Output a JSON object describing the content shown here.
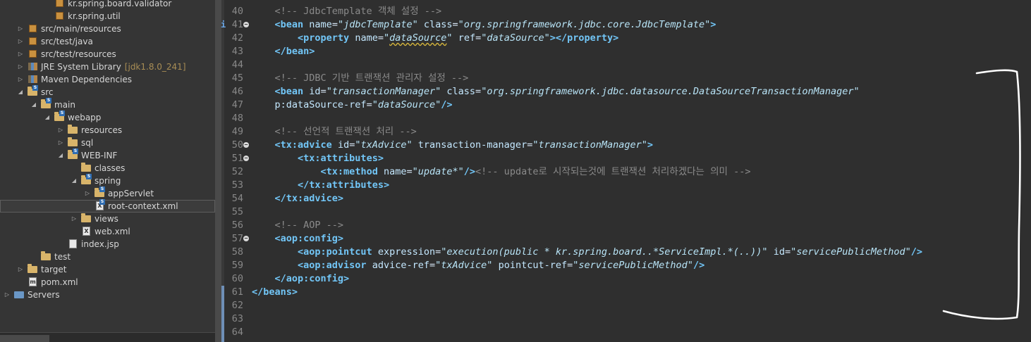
{
  "explorer": {
    "items": [
      {
        "label": "kr.spring.board.validator",
        "type": "package",
        "indent": 3,
        "expanded": null
      },
      {
        "label": "kr.spring.util",
        "type": "package",
        "indent": 3,
        "expanded": null
      },
      {
        "label": "src/main/resources",
        "type": "srcfolder",
        "indent": 1,
        "expanded": false
      },
      {
        "label": "src/test/java",
        "type": "srcfolder",
        "indent": 1,
        "expanded": false
      },
      {
        "label": "src/test/resources",
        "type": "srcfolder",
        "indent": 1,
        "expanded": false
      },
      {
        "label": "JRE System Library",
        "decoration": "[jdk1.8.0_241]",
        "type": "library",
        "indent": 1,
        "expanded": false
      },
      {
        "label": "Maven Dependencies",
        "type": "library",
        "indent": 1,
        "expanded": false
      },
      {
        "label": "src",
        "type": "folder-s",
        "indent": 1,
        "expanded": true
      },
      {
        "label": "main",
        "type": "folder-s",
        "indent": 2,
        "expanded": true
      },
      {
        "label": "webapp",
        "type": "folder-s",
        "indent": 3,
        "expanded": true
      },
      {
        "label": "resources",
        "type": "folder",
        "indent": 4,
        "expanded": false
      },
      {
        "label": "sql",
        "type": "folder",
        "indent": 4,
        "expanded": false
      },
      {
        "label": "WEB-INF",
        "type": "folder-s",
        "indent": 4,
        "expanded": true
      },
      {
        "label": "classes",
        "type": "folder",
        "indent": 5,
        "expanded": null
      },
      {
        "label": "spring",
        "type": "folder-s",
        "indent": 5,
        "expanded": true
      },
      {
        "label": "appServlet",
        "type": "folder-s",
        "indent": 6,
        "expanded": false
      },
      {
        "label": "root-context.xml",
        "type": "xml-s",
        "indent": 6,
        "expanded": null,
        "selected": true
      },
      {
        "label": "views",
        "type": "folder",
        "indent": 5,
        "expanded": false
      },
      {
        "label": "web.xml",
        "type": "xml",
        "indent": 5,
        "expanded": null
      },
      {
        "label": "index.jsp",
        "type": "jsp",
        "indent": 4,
        "expanded": null
      },
      {
        "label": "test",
        "type": "folder",
        "indent": 2,
        "expanded": null
      },
      {
        "label": "target",
        "type": "folder",
        "indent": 1,
        "expanded": false
      },
      {
        "label": "pom.xml",
        "type": "pom",
        "indent": 1,
        "expanded": null
      },
      {
        "label": "Servers",
        "type": "servers",
        "indent": 0,
        "expanded": false
      }
    ]
  },
  "editor": {
    "lines": [
      {
        "num": "40",
        "segs": [
          [
            "    ",
            "p"
          ],
          [
            "<!-- JdbcTemplate 객체 설정 -->",
            "c"
          ]
        ]
      },
      {
        "num": "41",
        "fold": true,
        "marker": "i",
        "segs": [
          [
            "    ",
            "p"
          ],
          [
            "<bean",
            "t"
          ],
          [
            " ",
            "p"
          ],
          [
            "name",
            "a"
          ],
          [
            "=",
            "p"
          ],
          [
            "\"jdbcTemplate\"",
            "v"
          ],
          [
            " ",
            "p"
          ],
          [
            "class",
            "a"
          ],
          [
            "=",
            "p"
          ],
          [
            "\"org.springframework.jdbc.core.JdbcTemplate\"",
            "v"
          ],
          [
            ">",
            "t"
          ]
        ]
      },
      {
        "num": "42",
        "segs": [
          [
            "        ",
            "p"
          ],
          [
            "<property",
            "t"
          ],
          [
            " ",
            "p"
          ],
          [
            "name",
            "a"
          ],
          [
            "=",
            "p"
          ],
          [
            "\"",
            "v"
          ],
          [
            "dataSource",
            "vm"
          ],
          [
            "\"",
            "v"
          ],
          [
            " ",
            "p"
          ],
          [
            "ref",
            "a"
          ],
          [
            "=",
            "p"
          ],
          [
            "\"dataSource\"",
            "v"
          ],
          [
            "></property>",
            "t"
          ]
        ]
      },
      {
        "num": "43",
        "segs": [
          [
            "    ",
            "p"
          ],
          [
            "</bean>",
            "t"
          ]
        ]
      },
      {
        "num": "44",
        "segs": []
      },
      {
        "num": "45",
        "segs": [
          [
            "    ",
            "p"
          ],
          [
            "<!-- JDBC 기반 트랜잭션 관리자 설정 -->",
            "c"
          ]
        ]
      },
      {
        "num": "46",
        "segs": [
          [
            "    ",
            "p"
          ],
          [
            "<bean",
            "t"
          ],
          [
            " ",
            "p"
          ],
          [
            "id",
            "a"
          ],
          [
            "=",
            "p"
          ],
          [
            "\"transactionManager\"",
            "v"
          ],
          [
            " ",
            "p"
          ],
          [
            "class",
            "a"
          ],
          [
            "=",
            "p"
          ],
          [
            "\"org.springframework.jdbc.datasource.DataSourceTransactionManager\"",
            "v"
          ]
        ]
      },
      {
        "num": "47",
        "segs": [
          [
            "    ",
            "p"
          ],
          [
            "p:dataSource-ref",
            "a"
          ],
          [
            "=",
            "p"
          ],
          [
            "\"dataSource\"",
            "v"
          ],
          [
            "/>",
            "t"
          ]
        ]
      },
      {
        "num": "48",
        "segs": []
      },
      {
        "num": "49",
        "segs": [
          [
            "    ",
            "p"
          ],
          [
            "<!-- 선언적 트랜잭션 처리 -->",
            "c"
          ]
        ]
      },
      {
        "num": "50",
        "fold": true,
        "segs": [
          [
            "    ",
            "p"
          ],
          [
            "<tx:advice",
            "t"
          ],
          [
            " ",
            "p"
          ],
          [
            "id",
            "a"
          ],
          [
            "=",
            "p"
          ],
          [
            "\"txAdvice\"",
            "v"
          ],
          [
            " ",
            "p"
          ],
          [
            "transaction-manager",
            "a"
          ],
          [
            "=",
            "p"
          ],
          [
            "\"transactionManager\"",
            "v"
          ],
          [
            ">",
            "t"
          ]
        ]
      },
      {
        "num": "51",
        "fold": true,
        "segs": [
          [
            "        ",
            "p"
          ],
          [
            "<tx:attributes>",
            "t"
          ]
        ]
      },
      {
        "num": "52",
        "segs": [
          [
            "            ",
            "p"
          ],
          [
            "<tx:method",
            "t"
          ],
          [
            " ",
            "p"
          ],
          [
            "name",
            "a"
          ],
          [
            "=",
            "p"
          ],
          [
            "\"update*\"",
            "v"
          ],
          [
            "/>",
            "t"
          ],
          [
            "<!-- update로 시작되는것에 트랜잭션 처리하겠다는 의미 -->",
            "c"
          ]
        ]
      },
      {
        "num": "53",
        "segs": [
          [
            "        ",
            "p"
          ],
          [
            "</tx:attributes>",
            "t"
          ]
        ]
      },
      {
        "num": "54",
        "segs": [
          [
            "    ",
            "p"
          ],
          [
            "</tx:advice>",
            "t"
          ]
        ]
      },
      {
        "num": "55",
        "segs": []
      },
      {
        "num": "56",
        "segs": [
          [
            "    ",
            "p"
          ],
          [
            "<!-- AOP -->",
            "c"
          ]
        ]
      },
      {
        "num": "57",
        "fold": true,
        "segs": [
          [
            "    ",
            "p"
          ],
          [
            "<aop:config>",
            "t"
          ]
        ]
      },
      {
        "num": "58",
        "segs": [
          [
            "        ",
            "p"
          ],
          [
            "<aop:pointcut",
            "t"
          ],
          [
            " ",
            "p"
          ],
          [
            "expression",
            "a"
          ],
          [
            "=",
            "p"
          ],
          [
            "\"execution(public * kr.spring.board..*ServiceImpl.*(..))\"",
            "v"
          ],
          [
            " ",
            "p"
          ],
          [
            "id",
            "a"
          ],
          [
            "=",
            "p"
          ],
          [
            "\"servicePublicMethod\"",
            "v"
          ],
          [
            "/>",
            "t"
          ]
        ]
      },
      {
        "num": "59",
        "segs": [
          [
            "        ",
            "p"
          ],
          [
            "<aop:advisor",
            "t"
          ],
          [
            " ",
            "p"
          ],
          [
            "advice-ref",
            "a"
          ],
          [
            "=",
            "p"
          ],
          [
            "\"txAdvice\"",
            "v"
          ],
          [
            " ",
            "p"
          ],
          [
            "pointcut-ref",
            "a"
          ],
          [
            "=",
            "p"
          ],
          [
            "\"servicePublicMethod\"",
            "v"
          ],
          [
            "/>",
            "t"
          ]
        ]
      },
      {
        "num": "60",
        "segs": [
          [
            "    ",
            "p"
          ],
          [
            "</aop:config>",
            "t"
          ]
        ]
      },
      {
        "num": "61",
        "segs": [
          [
            "</beans>",
            "t"
          ]
        ]
      },
      {
        "num": "62",
        "segs": []
      },
      {
        "num": "63",
        "segs": []
      },
      {
        "num": "64",
        "segs": []
      }
    ]
  }
}
